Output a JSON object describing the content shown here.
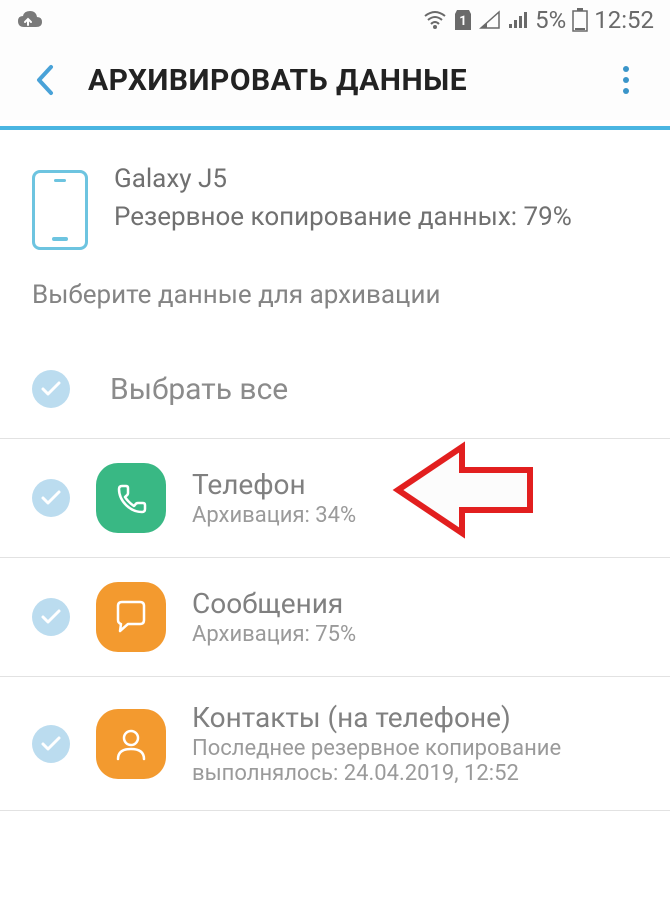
{
  "status": {
    "battery": "5%",
    "time": "12:52",
    "sim": "1"
  },
  "header": {
    "title": "АРХИВИРОВАТЬ ДАННЫЕ"
  },
  "device": {
    "name": "Galaxy J5",
    "desc": "Резервное копирование данных: 79%"
  },
  "instruction": "Выберите данные для архивации",
  "selectAll": "Выбрать все",
  "items": [
    {
      "title": "Телефон",
      "sub": "Архивация: 34%"
    },
    {
      "title": "Сообщения",
      "sub": "Архивация: 75%"
    },
    {
      "title": "Контакты (на телефоне)",
      "sub": "Последнее резервное копирование выполнялось: 24.04.2019, 12:52"
    }
  ]
}
